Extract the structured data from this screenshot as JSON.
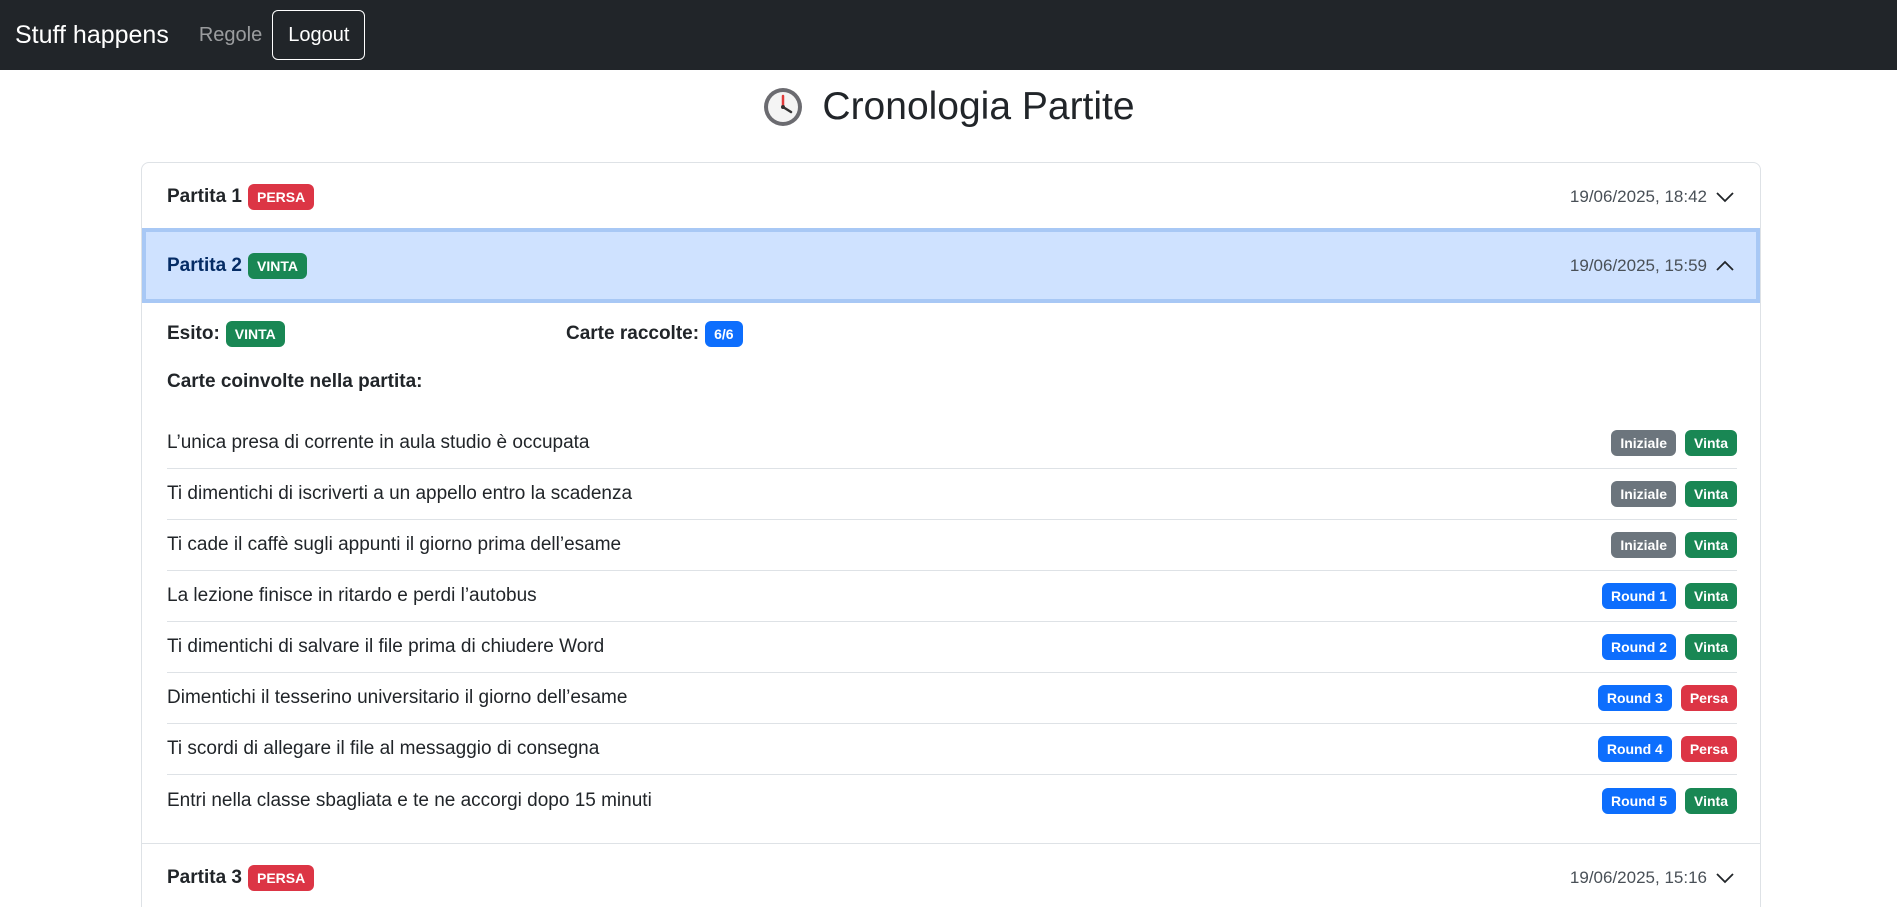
{
  "navbar": {
    "brand": "Stuff happens",
    "rules_link": "Regole",
    "logout_label": "Logout"
  },
  "page": {
    "title": "Cronologia Partite",
    "title_icon": "clock-icon"
  },
  "games": [
    {
      "title": "Partita 1",
      "status": "PERSA",
      "date": "19/06/2025, 18:42",
      "expanded": false
    },
    {
      "title": "Partita 2",
      "status": "VINTA",
      "date": "19/06/2025, 15:59",
      "expanded": true
    },
    {
      "title": "Partita 3",
      "status": "PERSA",
      "date": "19/06/2025, 15:16",
      "expanded": false
    }
  ],
  "details": {
    "esito_label": "Esito:",
    "esito_value": "VINTA",
    "carte_label": "Carte raccolte:",
    "carte_value": "6/6",
    "involved_label": "Carte coinvolte nella partita:",
    "cards": [
      {
        "text": "L’unica presa di corrente in aula studio è occupata",
        "round": "Iniziale",
        "result": "Vinta"
      },
      {
        "text": "Ti dimentichi di iscriverti a un appello entro la scadenza",
        "round": "Iniziale",
        "result": "Vinta"
      },
      {
        "text": "Ti cade il caffè sugli appunti il giorno prima dell’esame",
        "round": "Iniziale",
        "result": "Vinta"
      },
      {
        "text": "La lezione finisce in ritardo e perdi l’autobus",
        "round": "Round 1",
        "result": "Vinta"
      },
      {
        "text": "Ti dimentichi di salvare il file prima di chiudere Word",
        "round": "Round 2",
        "result": "Vinta"
      },
      {
        "text": "Dimentichi il tesserino universitario il giorno dell’esame",
        "round": "Round 3",
        "result": "Persa"
      },
      {
        "text": "Ti scordi di allegare il file al messaggio di consegna",
        "round": "Round 4",
        "result": "Persa"
      },
      {
        "text": "Entri nella classe sbagliata e te ne accorgi dopo 15 minuti",
        "round": "Round 5",
        "result": "Vinta"
      }
    ]
  },
  "colors": {
    "navbar_bg": "#212529",
    "danger": "#dc3545",
    "success": "#198754",
    "primary": "#0d6efd",
    "secondary": "#6c757d",
    "active_header_bg": "#cfe2ff"
  }
}
